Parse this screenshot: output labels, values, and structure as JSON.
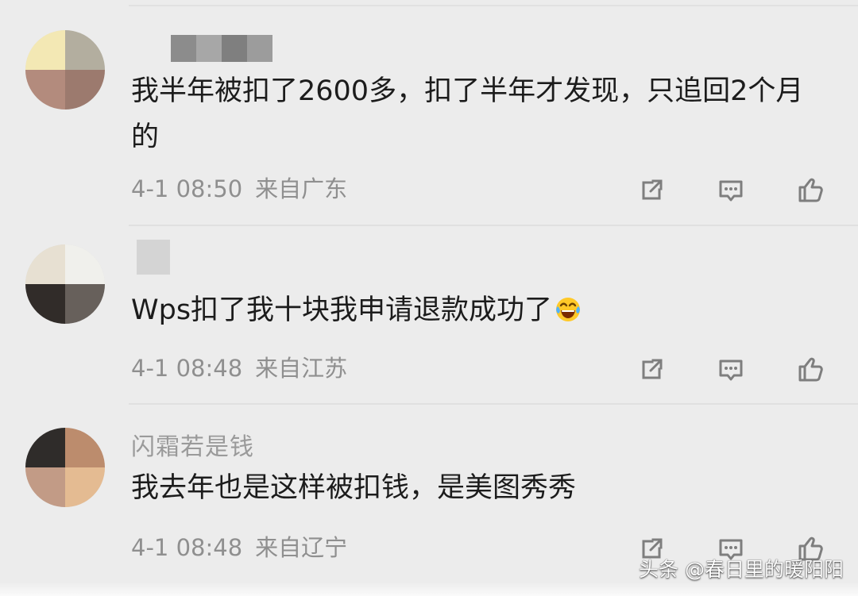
{
  "comments": [
    {
      "username": "",
      "text": "我半年被扣了2600多，扣了半年才发现，只追回2个月的",
      "time": "4-1 08:50",
      "location": "来自广东",
      "avatar_colors": {
        "tl": "#f3e8b4",
        "tr": "#b3ae9f",
        "bl": "#b38b7d",
        "br": "#9c7a6e"
      }
    },
    {
      "username": "",
      "text": "Wps扣了我十块我申请退款成功了",
      "time": "4-1 08:48",
      "location": "来自江苏",
      "avatar_colors": {
        "tl": "#e7e0d2",
        "tr": "#f0f0ec",
        "bl": "#312c29",
        "br": "#67605b"
      }
    },
    {
      "username": "闪霜若是钱",
      "text": "我去年也是这样被扣钱，是美图秀秀",
      "time": "4-1 08:48",
      "location": "来自辽宁",
      "avatar_colors": {
        "tl": "#2f2c2a",
        "tr": "#bc8c6d",
        "bl": "#c29b86",
        "br": "#e4bb92"
      }
    }
  ],
  "icons": {
    "share": "share-icon",
    "comment": "comment-icon",
    "like": "thumb-up-icon",
    "emoji": "laughing-crying-emoji"
  },
  "watermark": "头条 @春日里的暖阳阳",
  "colors": {
    "background": "#ececec",
    "text_primary": "#1c1c1c",
    "text_secondary": "#8f8f8f",
    "icon": "#7e7e7e"
  }
}
